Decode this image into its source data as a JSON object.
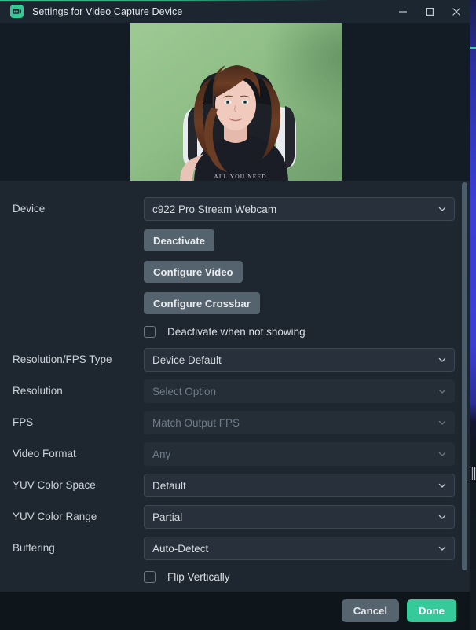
{
  "window": {
    "title": "Settings for Video Capture Device",
    "app_icon": "video-capture-icon",
    "controls": {
      "minimize": "minimize-icon",
      "maximize": "maximize-icon",
      "close": "close-icon"
    }
  },
  "preview": {
    "alt": "webcam-live-preview",
    "shirt_text": "ALL YOU NEED"
  },
  "form": {
    "device": {
      "label": "Device",
      "value": "c922 Pro Stream Webcam",
      "disabled": false
    },
    "deactivate_button": "Deactivate",
    "configure_video_button": "Configure Video",
    "configure_crossbar_button": "Configure Crossbar",
    "deactivate_when_not_showing": {
      "label": "Deactivate when not showing",
      "checked": false
    },
    "resolution_fps_type": {
      "label": "Resolution/FPS Type",
      "value": "Device Default",
      "disabled": false
    },
    "resolution": {
      "label": "Resolution",
      "value": "Select Option",
      "disabled": true
    },
    "fps": {
      "label": "FPS",
      "value": "Match Output FPS",
      "disabled": true
    },
    "video_format": {
      "label": "Video Format",
      "value": "Any",
      "disabled": true
    },
    "yuv_color_space": {
      "label": "YUV Color Space",
      "value": "Default",
      "disabled": false
    },
    "yuv_color_range": {
      "label": "YUV Color Range",
      "value": "Partial",
      "disabled": false
    },
    "buffering": {
      "label": "Buffering",
      "value": "Auto-Detect",
      "disabled": false
    },
    "flip_vertically": {
      "label": "Flip Vertically",
      "checked": false
    }
  },
  "footer": {
    "cancel_label": "Cancel",
    "done_label": "Done"
  },
  "colors": {
    "accent": "#36c99a",
    "window_bg": "#1e262f",
    "titlebar_bg": "#1b2631",
    "footer_bg": "#0e161c",
    "field_bg": "#28313b",
    "button_bg": "#55636e",
    "label_text": "#ccd2d8",
    "disabled_text": "#707c88"
  }
}
